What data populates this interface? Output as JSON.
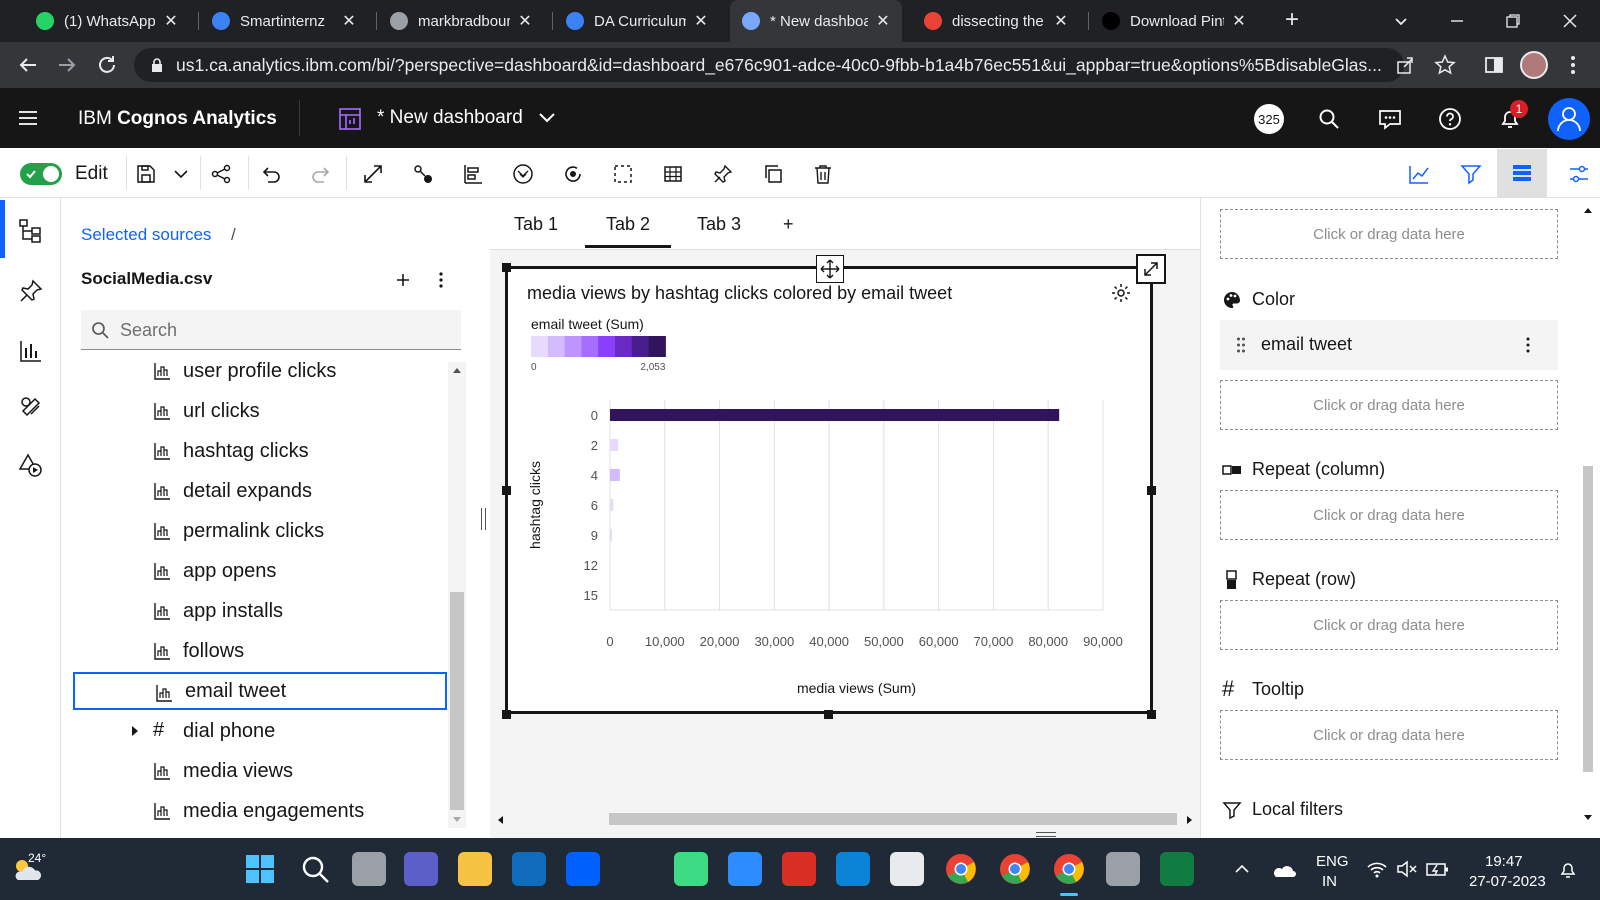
{
  "browser": {
    "tabs": [
      {
        "title": "(1) WhatsApp",
        "icon": "whatsapp-icon",
        "color": "#25d366"
      },
      {
        "title": "Smartinternz",
        "icon": "page-icon",
        "color": "#3b82f6"
      },
      {
        "title": "markbradbourn",
        "icon": "github-icon",
        "color": "#9aa0a6"
      },
      {
        "title": "DA Curriculum",
        "icon": "page-icon",
        "color": "#3b82f6"
      },
      {
        "title": "* New dashboa",
        "icon": "cognos-icon",
        "color": "#78a9ff"
      },
      {
        "title": "dissecting the",
        "icon": "google-icon",
        "color": "#ea4335"
      },
      {
        "title": "Download Pint",
        "icon": "g-icon",
        "color": "#000000"
      }
    ],
    "url": "us1.ca.analytics.ibm.com/bi/?perspective=dashboard&id=dashboard_e676c901-adce-40c0-9fbb-b1a4b76ec551&ui_appbar=true&options%5BdisableGlas..."
  },
  "app": {
    "brand_prefix": "IBM ",
    "brand_name": "Cognos Analytics",
    "dashboard_title": "* New dashboard",
    "badge_count": "325",
    "notification_count": "1"
  },
  "toolbar": {
    "edit_label": "Edit"
  },
  "sources": {
    "breadcrumb": "Selected sources",
    "separator": "/",
    "source_name": "SocialMedia.csv",
    "search_placeholder": "Search",
    "fields": [
      {
        "label": "user profile clicks",
        "type": "measure"
      },
      {
        "label": "url clicks",
        "type": "measure"
      },
      {
        "label": "hashtag clicks",
        "type": "measure"
      },
      {
        "label": "detail expands",
        "type": "measure"
      },
      {
        "label": "permalink clicks",
        "type": "measure"
      },
      {
        "label": "app opens",
        "type": "measure"
      },
      {
        "label": "app installs",
        "type": "measure"
      },
      {
        "label": "follows",
        "type": "measure"
      },
      {
        "label": "email tweet",
        "type": "measure",
        "selected": true
      },
      {
        "label": "dial phone",
        "type": "identifier",
        "expandable": true
      },
      {
        "label": "media views",
        "type": "measure"
      },
      {
        "label": "media engagements",
        "type": "measure"
      }
    ]
  },
  "canvas": {
    "tabs": [
      "Tab 1",
      "Tab 2",
      "Tab 3"
    ],
    "active_tab": "Tab 2",
    "add_tab": "+"
  },
  "chart_data": {
    "type": "bar",
    "orientation": "horizontal",
    "title": "media views by hashtag clicks colored by email tweet",
    "xlabel": "media views (Sum)",
    "ylabel": "hashtag clicks",
    "categories": [
      "0",
      "2",
      "4",
      "6",
      "9",
      "12",
      "15"
    ],
    "values": [
      82000,
      1500,
      1800,
      600,
      300,
      0,
      0
    ],
    "xlim": [
      0,
      90000
    ],
    "x_ticks": [
      "0",
      "10,000",
      "20,000",
      "30,000",
      "40,000",
      "50,000",
      "60,000",
      "70,000",
      "80,000",
      "90,000"
    ],
    "legend": {
      "title": "email tweet (Sum)",
      "min_label": "0",
      "max_label": "2,053",
      "colors": [
        "#e8daff",
        "#d4bbff",
        "#be95ff",
        "#a56eff",
        "#8a3ffc",
        "#6929c4",
        "#491d8b",
        "#31135e"
      ]
    },
    "bar_colors": [
      "#31135e",
      "#e8daff",
      "#d4bbff",
      "#e8daff",
      "#e8daff",
      "#e8daff",
      "#e8daff"
    ],
    "grid": true
  },
  "properties": {
    "drop_placeholder": "Click or drag data here",
    "color_label": "Color",
    "color_field": "email tweet",
    "repeat_column": "Repeat (column)",
    "repeat_row": "Repeat (row)",
    "tooltip": "Tooltip",
    "local_filters": "Local filters"
  },
  "taskbar": {
    "temperature": "24°",
    "lang_top": "ENG",
    "lang_bottom": "IN",
    "time": "19:47",
    "date": "27-07-2023"
  }
}
